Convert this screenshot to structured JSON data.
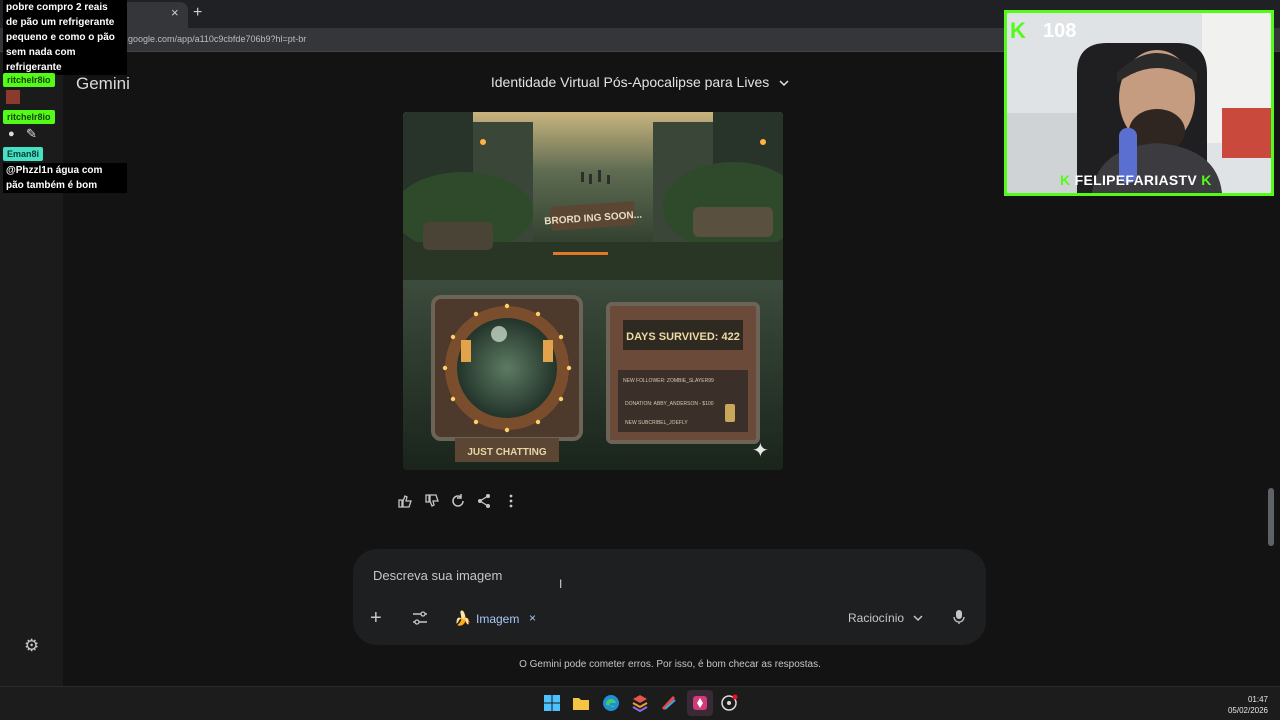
{
  "browser": {
    "url": "https://gemini.google.com/app/a110c9cbfde706b9?hl=pt-br",
    "tab_close": "×",
    "new_tab": "+"
  },
  "app": {
    "brand": "Gemini",
    "conversation_title": "Identidade Virtual Pós-Apocalipse para Lives",
    "title_chevron_icon": "chevron-down-icon"
  },
  "generated_image": {
    "top_sign": "BRORD ING SOON...",
    "days_survived": "DAYS SURVIVED: 422",
    "alerts": [
      "NEW FOLLOWER: ZOMBIE_SLAYER99",
      "DONATION: ABBY_ANDERSON - $100",
      "NEW SUBCRIBEL_JOEFLY"
    ],
    "just_chatting": "JUST CHATTING"
  },
  "prompt": {
    "placeholder": "Descreva sua imagem",
    "chip_label": "Imagem",
    "chip_remove": "×",
    "model": "Raciocínio",
    "model_chevron": "⌄"
  },
  "disclaimer": "O Gemini pode cometer erros. Por isso, é bom checar as respostas.",
  "chat_overlay": {
    "message1_lines": [
      "pobre compro 2 reais",
      "de pão um refrigerante",
      "pequeno e como o pão",
      "sem nada com",
      "refrigerante"
    ],
    "user1": "ritchelr8io",
    "user2": "ritchelr8io",
    "user3": "Eman8i",
    "message2_lines": [
      "@Phzzl1n água com",
      "pão também é bom"
    ]
  },
  "webcam": {
    "viewer_count": "108",
    "channel_name": "FELIPEFARIASTV",
    "accent": "#53fc18"
  },
  "taskbar": {
    "time": "01:47",
    "date": "05/02/2026"
  }
}
